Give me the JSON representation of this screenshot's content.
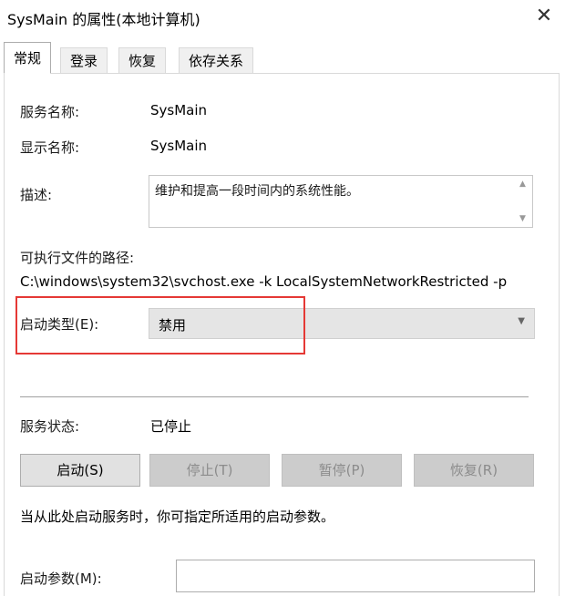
{
  "window": {
    "title": "SysMain 的属性(本地计算机)",
    "close_glyph": "✕"
  },
  "tabs": [
    {
      "label": "常规",
      "active": true
    },
    {
      "label": "登录",
      "active": false
    },
    {
      "label": "恢复",
      "active": false
    },
    {
      "label": "依存关系",
      "active": false
    }
  ],
  "general": {
    "service_name_label": "服务名称:",
    "service_name": "SysMain",
    "display_name_label": "显示名称:",
    "display_name": "SysMain",
    "description_label": "描述:",
    "description": "维护和提高一段时间内的系统性能。",
    "path_label": "可执行文件的路径:",
    "path": "C:\\windows\\system32\\svchost.exe -k LocalSystemNetworkRestricted -p",
    "startup_type_label": "启动类型(E):",
    "startup_type_value": "禁用",
    "status_label": "服务状态:",
    "status_value": "已停止",
    "buttons": {
      "start": "启动(S)",
      "stop": "停止(T)",
      "pause": "暂停(P)",
      "resume": "恢复(R)"
    },
    "hint": "当从此处启动服务时，你可指定所适用的启动参数。",
    "start_params_label": "启动参数(M):",
    "start_params_value": ""
  },
  "colors": {
    "highlight": "#e53935",
    "disabled_button": "#cccccc",
    "select_background": "#e5e5e5"
  },
  "icons": {
    "close": "close-icon",
    "scroll_up": "chevron-up-icon",
    "scroll_down": "chevron-down-icon",
    "dropdown": "chevron-down-icon"
  }
}
